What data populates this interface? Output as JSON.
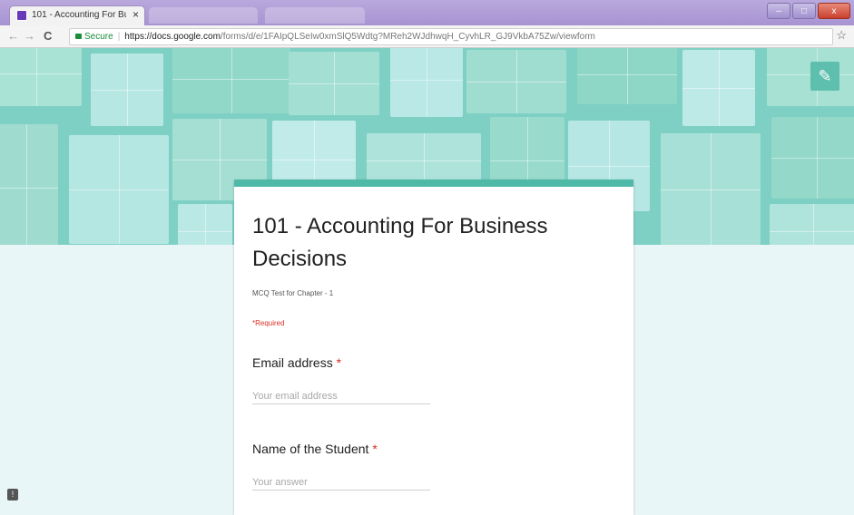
{
  "browser": {
    "tab_title": "101 - Accounting For Bu",
    "tab_close": "×",
    "back": "←",
    "forward": "→",
    "reload": "C",
    "secure_label": "Secure",
    "url_host": "https://docs.google.com",
    "url_path": "/forms/d/e/1FAIpQLSeIw0xmSlQ5Wdtg?MReh2WJdhwqH_CyvhLR_GJ9VkbA75Zw/viewform",
    "window_controls": {
      "minimize": "–",
      "maximize": "□",
      "close": "x"
    },
    "icons": {
      "lock": "lock-icon",
      "star": "star-icon"
    }
  },
  "form": {
    "title": "101 - Accounting For Business Decisions",
    "description": "MCQ Test for Chapter - 1",
    "required_note": "*Required",
    "questions": [
      {
        "label": "Email address",
        "required_mark": "*",
        "placeholder": "Your email address"
      },
      {
        "label": "Name of the Student",
        "required_mark": "*",
        "placeholder": "Your answer"
      }
    ]
  },
  "colors": {
    "accent": "#4fb9a8",
    "header_bg": "#7fd0c4",
    "page_bg": "#e8f6f7",
    "required": "#d93025"
  }
}
